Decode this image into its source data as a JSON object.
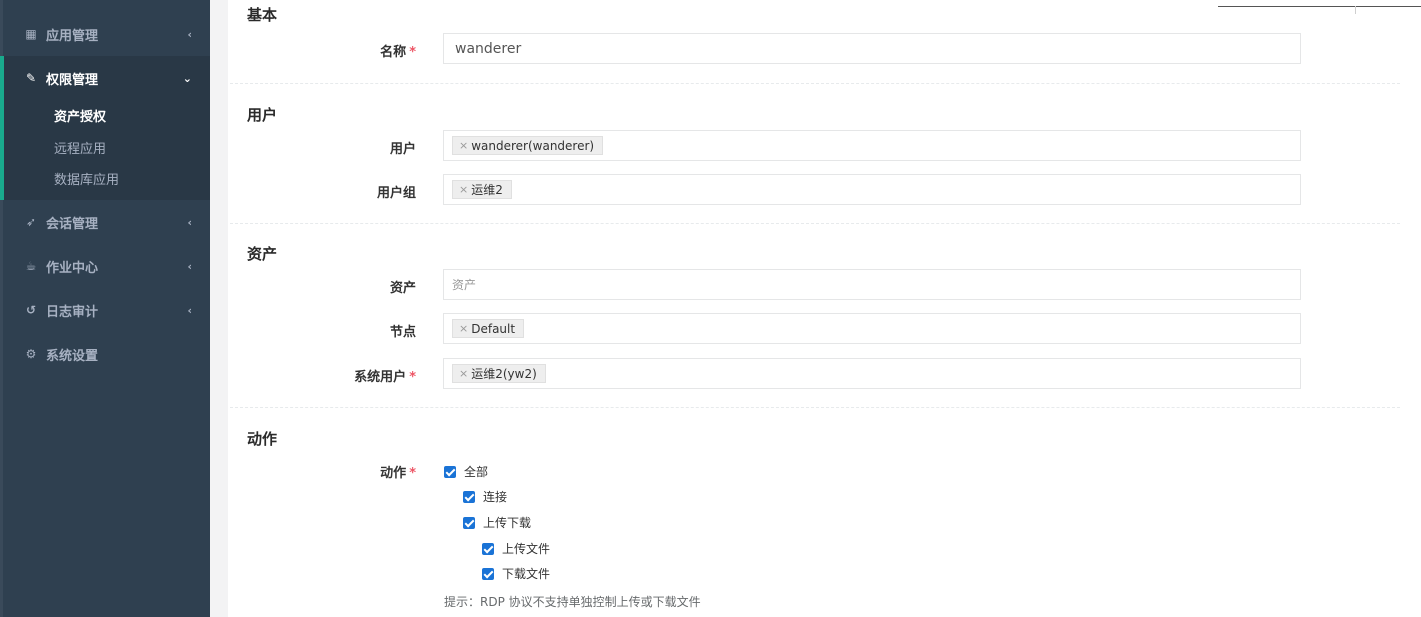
{
  "sidebar": {
    "items": [
      {
        "label": "应用管理",
        "icon": "grid-icon",
        "arrow": "‹"
      },
      {
        "label": "权限管理",
        "icon": "edit-icon",
        "arrow": "⌄"
      },
      {
        "label": "会话管理",
        "icon": "rocket-icon",
        "arrow": "‹"
      },
      {
        "label": "作业中心",
        "icon": "coffee-icon",
        "arrow": "‹"
      },
      {
        "label": "日志审计",
        "icon": "history-icon",
        "arrow": "‹"
      },
      {
        "label": "系统设置",
        "icon": "gears-icon",
        "arrow": ""
      }
    ],
    "sub_items": [
      "资产授权",
      "远程应用",
      "数据库应用"
    ]
  },
  "form": {
    "sections": {
      "basic": "基本",
      "user": "用户",
      "asset": "资产",
      "action": "动作"
    },
    "name": {
      "label": "名称",
      "required": "*",
      "value": "wanderer"
    },
    "users": {
      "label": "用户",
      "tags": [
        "wanderer(wanderer)"
      ]
    },
    "user_groups": {
      "label": "用户组",
      "tags": [
        "运维2"
      ]
    },
    "assets": {
      "label": "资产",
      "placeholder": "资产"
    },
    "nodes": {
      "label": "节点",
      "tags": [
        "Default"
      ]
    },
    "system_users": {
      "label": "系统用户",
      "required": "*",
      "tags": [
        "运维2(yw2)"
      ]
    },
    "actions": {
      "label": "动作",
      "required": "*",
      "options": [
        "全部",
        "连接",
        "上传下载",
        "上传文件",
        "下载文件"
      ]
    },
    "hint": "提示：RDP 协议不支持单独控制上传或下载文件",
    "tag_remove": "×"
  },
  "colors": {
    "sidebar_bg": "#2f4050",
    "active_border": "#19aa8d",
    "required": "#ed5565",
    "checkbox": "#1a73d6"
  }
}
